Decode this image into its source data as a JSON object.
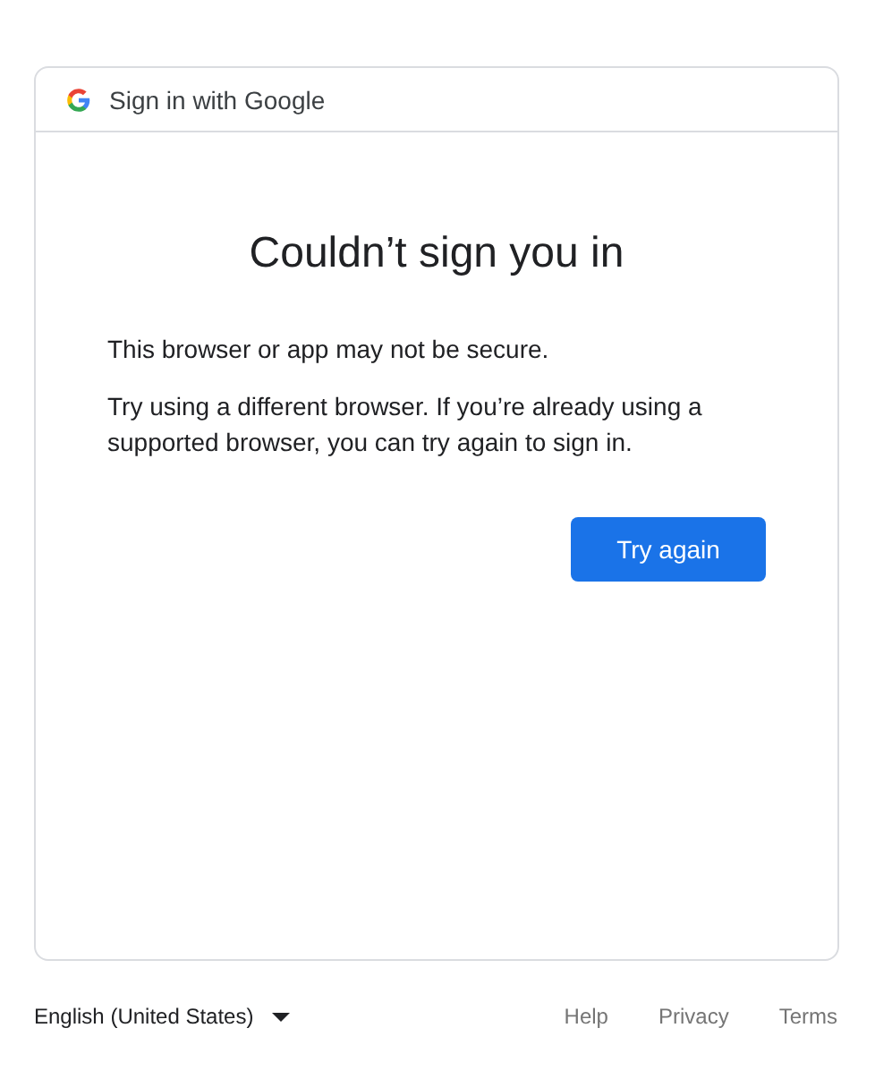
{
  "header": {
    "title": "Sign in with Google"
  },
  "heading": "Couldn’t sign you in",
  "paragraphs": [
    "This browser or app may not be secure.",
    "Try using a different browser. If you’re already using a supported browser, you can try again to sign in."
  ],
  "button": {
    "label": "Try again"
  },
  "footer": {
    "language": "English (United States)",
    "links": [
      "Help",
      "Privacy",
      "Terms"
    ]
  }
}
